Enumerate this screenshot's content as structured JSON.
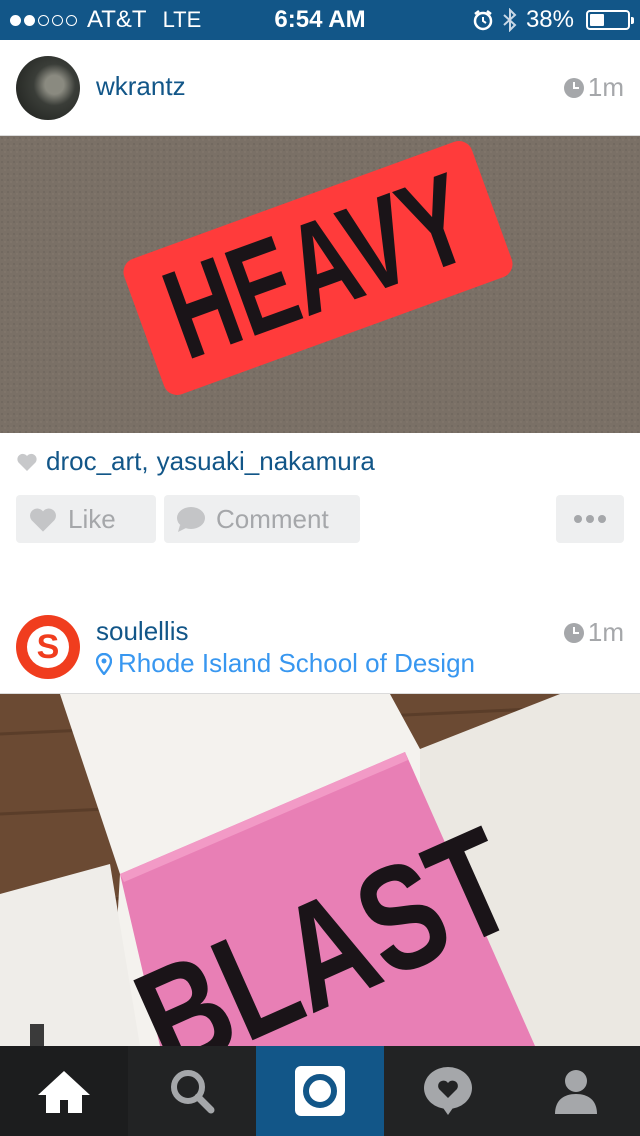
{
  "status_bar": {
    "carrier": "AT&T",
    "network": "LTE",
    "time": "6:54 AM",
    "battery": "38%",
    "battery_level": 0.38,
    "signal_bars_filled": 2,
    "signal_bars_total": 5
  },
  "posts": [
    {
      "username": "wkrantz",
      "timestamp": "1m",
      "photo_text": "HEAVY",
      "likers": [
        "droc_art",
        "yasuaki_nakamura"
      ],
      "like_label": "Like",
      "comment_label": "Comment"
    },
    {
      "username": "soulellis",
      "location": "Rhode Island School of Design",
      "timestamp": "1m",
      "avatar_letter": "S",
      "photo_text": "BLAST"
    }
  ],
  "tabbar": {
    "items": [
      {
        "icon": "home-icon"
      },
      {
        "icon": "search-icon"
      },
      {
        "icon": "camera-icon"
      },
      {
        "icon": "activity-heart-icon"
      },
      {
        "icon": "profile-icon"
      }
    ]
  },
  "colors": {
    "brand_blue": "#125688",
    "link_blue": "#3897f0",
    "gray": "#a5a7aa",
    "button_bg": "#eeeff0",
    "sticker_red": "#ff3b3b",
    "book_pink": "#e87fb5"
  }
}
